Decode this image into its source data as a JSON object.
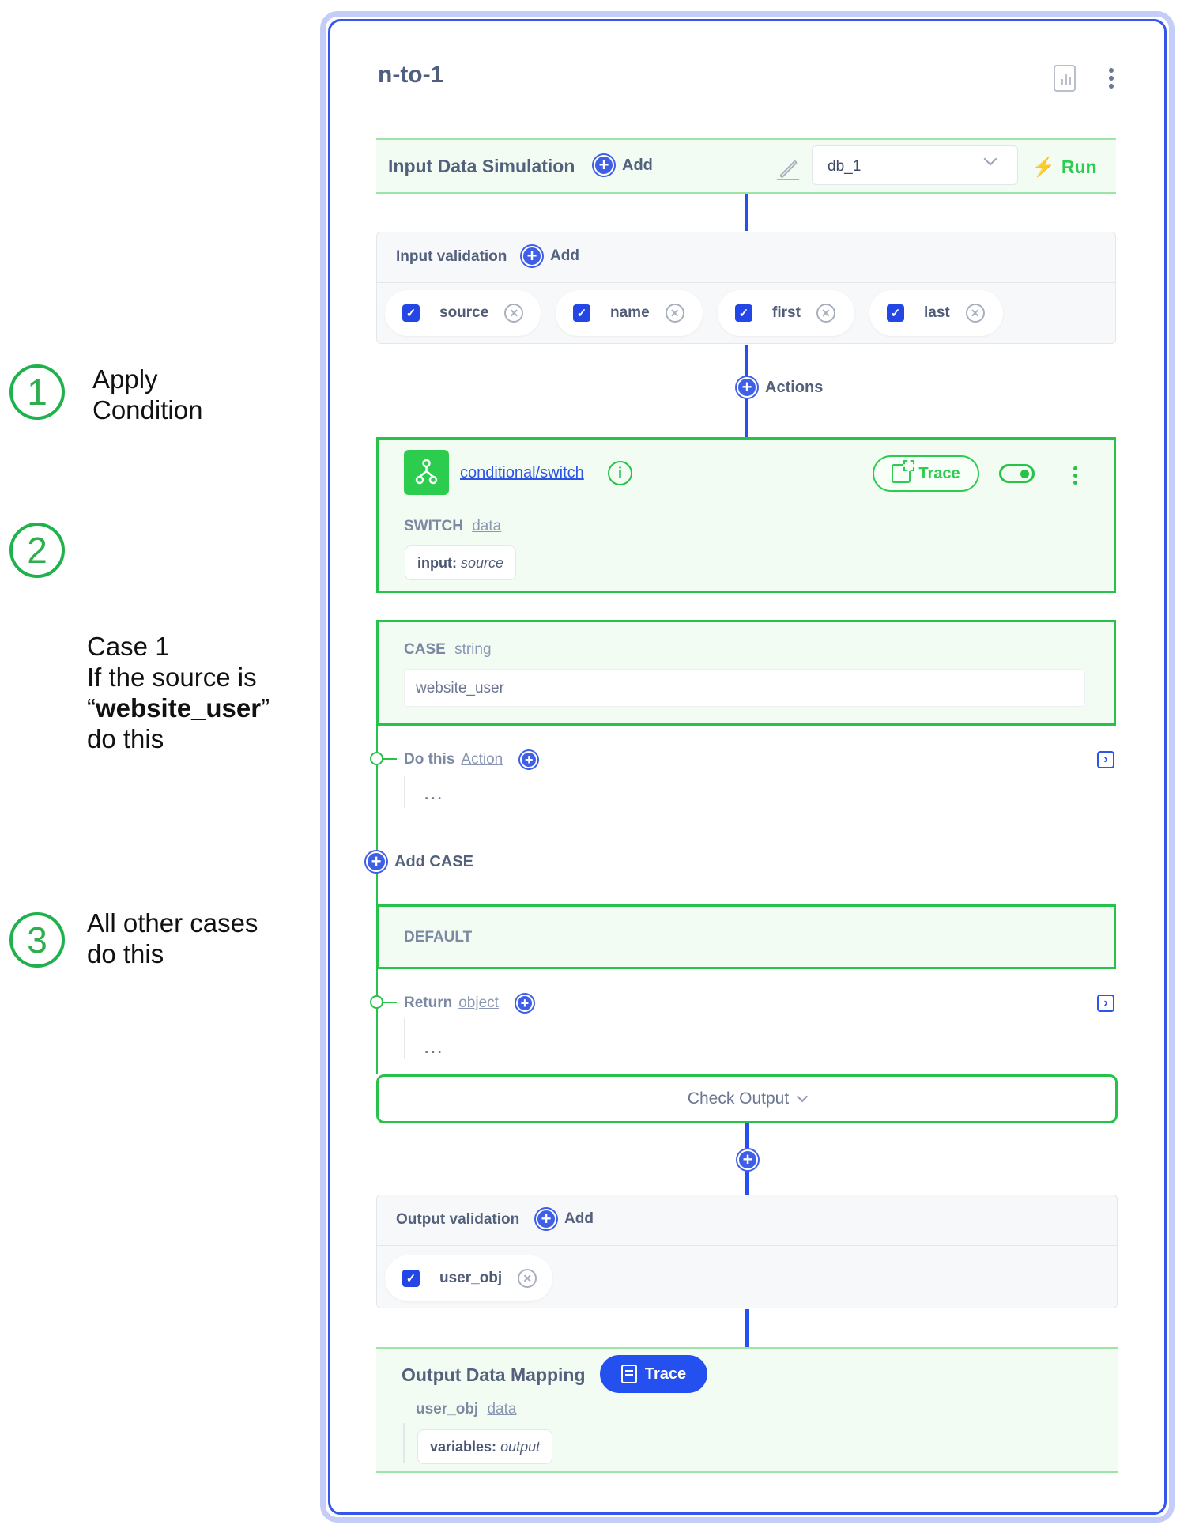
{
  "annotations": [
    {
      "number": "1",
      "lines": [
        "Apply",
        "Condition"
      ]
    },
    {
      "number": "2",
      "lines": [
        "Case 1",
        "If the source is"
      ],
      "quote_open": "“",
      "bold": "website_user",
      "quote_close": "”",
      "after": "do this"
    },
    {
      "number": "3",
      "lines": [
        "All other cases",
        "do this"
      ]
    }
  ],
  "title": "n-to-1",
  "input_sim": {
    "label": "Input Data Simulation",
    "add": "Add",
    "db_value": "db_1",
    "run": "Run"
  },
  "input_validation": {
    "label": "Input validation",
    "add": "Add",
    "fields": [
      "source",
      "name",
      "first",
      "last"
    ]
  },
  "actions_label": "Actions",
  "switch_node": {
    "name": "conditional/switch",
    "trace": "Trace",
    "switch_label": "SWITCH",
    "switch_type": "data",
    "input_key": "input:",
    "input_value": "source"
  },
  "case": {
    "label": "CASE",
    "type": "string",
    "value": "website_user"
  },
  "do_this": {
    "label": "Do this",
    "type": "Action",
    "placeholder": "..."
  },
  "add_case": "Add CASE",
  "default_label": "DEFAULT",
  "return": {
    "label": "Return",
    "type": "object",
    "placeholder": "..."
  },
  "check_output": "Check Output",
  "output_validation": {
    "label": "Output validation",
    "add": "Add",
    "fields": [
      "user_obj"
    ]
  },
  "output_mapping": {
    "label": "Output Data Mapping",
    "trace": "Trace",
    "field": "user_obj",
    "field_type": "data",
    "var_key": "variables:",
    "var_value": "output"
  },
  "colors": {
    "accent_blue": "#2450f0",
    "accent_green": "#26c24a",
    "outline": "#c3cdf7"
  }
}
